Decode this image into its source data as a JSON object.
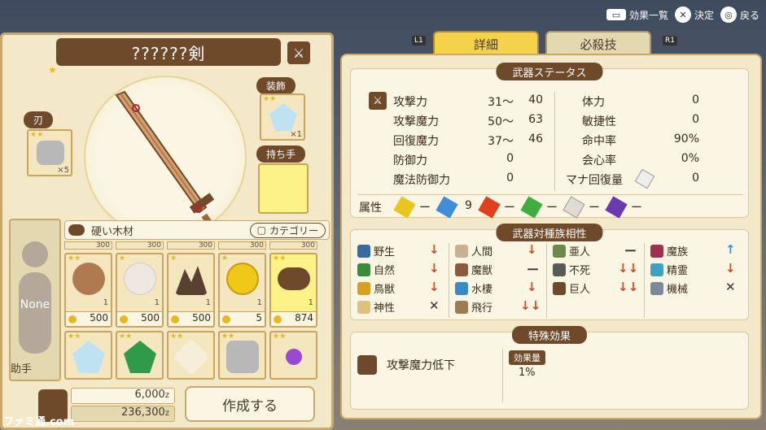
{
  "hints": [
    {
      "key": "▭",
      "label": "効果一覧"
    },
    {
      "key": "✕",
      "label": "決定"
    },
    {
      "key": "◎",
      "label": "戻る"
    }
  ],
  "item": {
    "title": "??????剣",
    "blade_label": "刃",
    "blade_count": "×5",
    "decor_label": "装飾",
    "decor_count": "×1",
    "grip_label": "持ち手"
  },
  "helper": {
    "name": "None",
    "label": "助手"
  },
  "material": {
    "name": "硬い木材",
    "category_button": "カテゴリー",
    "partial_prices": [
      "300",
      "300",
      "300",
      "300",
      "300"
    ],
    "row1": [
      {
        "qty": "1",
        "price": "500"
      },
      {
        "qty": "1",
        "price": "500"
      },
      {
        "qty": "1",
        "price": "500"
      },
      {
        "qty": "1",
        "price": "5"
      },
      {
        "qty": "1",
        "price": "874"
      }
    ]
  },
  "money": {
    "cost": "6,000",
    "cost_unit": "z",
    "total": "236,300",
    "total_unit": "z"
  },
  "create_button": "作成する",
  "tabs": {
    "left_bumper": "L1",
    "right_bumper": "R1",
    "details": "詳細",
    "special": "必殺技"
  },
  "weapon_status": {
    "title": "武器ステータス",
    "rows_left": [
      {
        "label": "攻撃力",
        "min": "31～",
        "max": "40"
      },
      {
        "label": "攻撃魔力",
        "min": "50～",
        "max": "63"
      },
      {
        "label": "回復魔力",
        "min": "37～",
        "max": "46"
      },
      {
        "label": "防御力",
        "min": "",
        "max": "0"
      },
      {
        "label": "魔法防御力",
        "min": "",
        "max": "0"
      }
    ],
    "rows_right": [
      {
        "label": "体力",
        "val": "0"
      },
      {
        "label": "敏捷性",
        "val": "0"
      },
      {
        "label": "命中率",
        "val": "90%"
      },
      {
        "label": "会心率",
        "val": "0%"
      },
      {
        "label": "マナ回復量",
        "val": "0"
      }
    ],
    "attribute_label": "属性",
    "attributes": [
      "ー",
      "9",
      "ー",
      "ー",
      "ー",
      "ー"
    ]
  },
  "affinity": {
    "title": "武器対種族相性",
    "races": [
      {
        "label": "野生",
        "mark": "↓",
        "type": "down"
      },
      {
        "label": "自然",
        "mark": "↓",
        "type": "down"
      },
      {
        "label": "鳥獣",
        "mark": "↓",
        "type": "down"
      },
      {
        "label": "神性",
        "mark": "✕",
        "type": "neutral"
      },
      {
        "label": "人間",
        "mark": "↓",
        "type": "down"
      },
      {
        "label": "魔獣",
        "mark": "ー",
        "type": "neutral"
      },
      {
        "label": "水棲",
        "mark": "↓",
        "type": "down"
      },
      {
        "label": "飛行",
        "mark": "↓↓",
        "type": "down"
      },
      {
        "label": "亜人",
        "mark": "ー",
        "type": "neutral"
      },
      {
        "label": "不死",
        "mark": "↓↓",
        "type": "down"
      },
      {
        "label": "巨人",
        "mark": "↓↓",
        "type": "down"
      },
      {
        "label": "魔族",
        "mark": "↑",
        "type": "up"
      },
      {
        "label": "精霊",
        "mark": "↓",
        "type": "down"
      },
      {
        "label": "機械",
        "mark": "✕",
        "type": "neutral"
      }
    ]
  },
  "special_effect": {
    "title": "特殊効果",
    "name": "攻撃魔力低下",
    "amount_label": "効果量",
    "amount": "1%"
  },
  "watermark": "ファミ通.com",
  "colors": {
    "accent": "#6e4a2a",
    "tab_active": "#f4d24a",
    "panel": "#f3e9c8",
    "down": "#d54a1c",
    "up": "#3f8fd8"
  }
}
